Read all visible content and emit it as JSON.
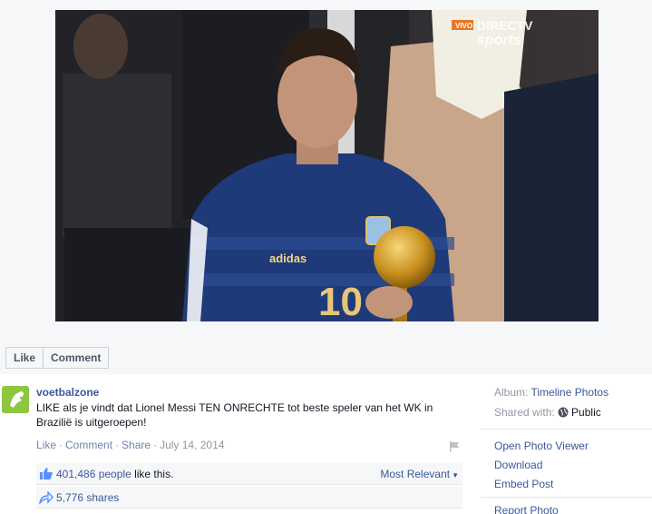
{
  "photo": {
    "broadcaster_tag": "VIVO",
    "broadcaster_name": "DIRECTV",
    "broadcaster_sub": "sports",
    "jersey_brand": "adidas",
    "jersey_number": "10"
  },
  "actions": {
    "like_label": "Like",
    "comment_label": "Comment"
  },
  "post": {
    "page_name": "voetbalzone",
    "caption": "LIKE als je vindt dat Lionel Messi TEN ONRECHTE tot beste speler van het WK in Brazilië is uitgeroepen!",
    "meta": {
      "like": "Like",
      "comment": "Comment",
      "share": "Share",
      "date": "July 14, 2014"
    },
    "likes": {
      "count_text": "401,486 people",
      "suffix": " like this.",
      "sort_label": "Most Relevant"
    },
    "shares": {
      "text": "5,776 shares"
    }
  },
  "sidebar": {
    "album_label": "Album:",
    "album_value": "Timeline Photos",
    "shared_label": "Shared with:",
    "shared_value": "Public",
    "links": {
      "open_viewer": "Open Photo Viewer",
      "download": "Download",
      "embed": "Embed Post",
      "report": "Report Photo"
    }
  },
  "colors": {
    "link": "#3b5998",
    "muted": "#9197a3",
    "avatar_green": "#8ec63f"
  },
  "icons": {
    "avatar": "voetbalzone-logo-icon",
    "flag": "flag-icon",
    "thumb": "thumbs-up-icon",
    "share": "share-arrow-icon",
    "globe": "globe-icon",
    "caret": "caret-down-icon"
  }
}
